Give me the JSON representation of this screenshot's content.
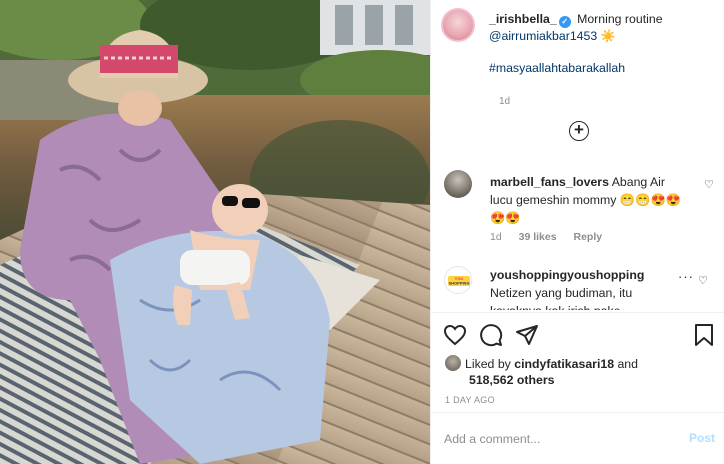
{
  "post": {
    "username": "_irishbella_",
    "caption_text": "Morning routine",
    "mention": "@airrumiakbar1453",
    "sun_emoji": "☀️",
    "hashtag": "#masyaallahtabarakallah",
    "time": "1d"
  },
  "comments": [
    {
      "username": "marbell_fans_lovers",
      "text": "Abang Air lucu gemeshin mommy 😁😁😍😍😍😍",
      "time": "1d",
      "likes": "39 likes",
      "reply": "Reply"
    },
    {
      "username": "youshoppingyoushopping",
      "text": "Netizen yang budiman, itu kayaknya kak irish pake",
      "avatar_text": "YOU SHOPPING"
    }
  ],
  "actions": {
    "liked_by_prefix": "Liked by",
    "liked_by_user": "cindyfatikasari18",
    "liked_by_and": "and",
    "likes_count": "518,562 others",
    "post_time": "1 DAY AGO"
  },
  "add_comment": {
    "placeholder": "Add a comment...",
    "post_label": "Post"
  },
  "icons": {
    "verified": "verified-badge-icon",
    "load_more": "plus-circle-icon",
    "like": "heart-icon",
    "comment": "comment-bubble-icon",
    "share": "paper-plane-icon",
    "save": "bookmark-icon"
  },
  "colors": {
    "link": "#00376b",
    "verified": "#3897f0",
    "muted": "#8e8e8e",
    "post_disabled": "#b2dffc"
  }
}
